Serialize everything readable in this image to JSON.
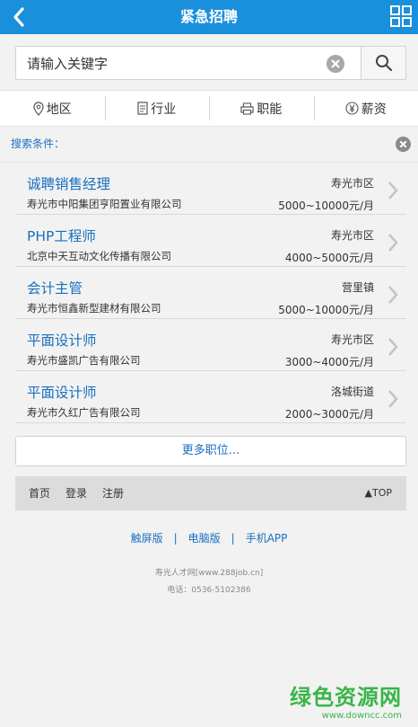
{
  "header": {
    "title": "紧急招聘"
  },
  "search": {
    "placeholder": "请输入关键字"
  },
  "filters": [
    {
      "label": "地区",
      "icon": "location-pin-icon"
    },
    {
      "label": "行业",
      "icon": "document-icon"
    },
    {
      "label": "职能",
      "icon": "printer-icon"
    },
    {
      "label": "薪资",
      "icon": "yen-icon"
    }
  ],
  "criteria": {
    "label": "搜索条件："
  },
  "jobs": [
    {
      "title": "诚聘销售经理",
      "location": "寿光市区",
      "company": "寿光市中阳集团亨阳置业有限公司",
      "salary": "5000~10000元/月"
    },
    {
      "title": "PHP工程师",
      "location": "寿光市区",
      "company": "北京中天互动文化传播有限公司",
      "salary": "4000~5000元/月"
    },
    {
      "title": "会计主管",
      "location": "营里镇",
      "company": "寿光市恒鑫新型建材有限公司",
      "salary": "5000~10000元/月"
    },
    {
      "title": "平面设计师",
      "location": "寿光市区",
      "company": "寿光市盛凯广告有限公司",
      "salary": "3000~4000元/月"
    },
    {
      "title": "平面设计师",
      "location": "洛城街道",
      "company": "寿光市久红广告有限公司",
      "salary": "2000~3000元/月"
    }
  ],
  "more": "更多职位...",
  "footnav": {
    "home": "首页",
    "login": "登录",
    "register": "注册",
    "top": "▲TOP"
  },
  "versions": {
    "touch": "触屏版",
    "pc": "电脑版",
    "app": "手机APP",
    "sep": "|"
  },
  "copyright": {
    "site": "寿光人才网[www.288job.cn]",
    "phone": "电话：0536-5102386"
  },
  "watermark": {
    "line1": "绿色资源网",
    "line2": "www.downcc.com"
  },
  "colors": {
    "header": "#1a8fdc",
    "link": "#1a6fc0",
    "watermark": "#39b54a"
  }
}
